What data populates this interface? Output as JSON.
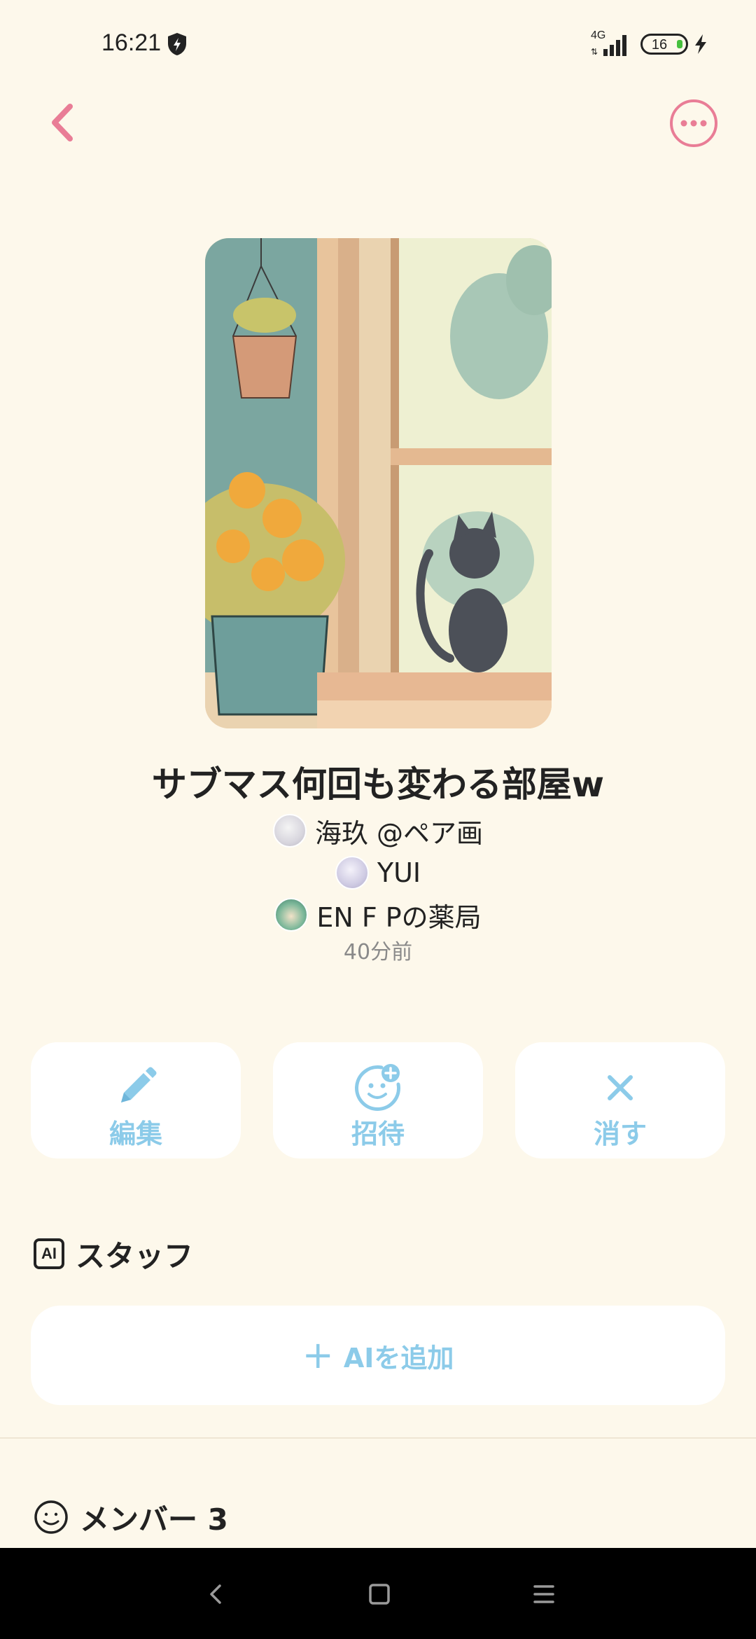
{
  "status_bar": {
    "time": "16:21",
    "network": "4G",
    "battery": "16"
  },
  "room": {
    "title": "サブマス何回も変わる部屋w",
    "members": [
      {
        "name": "海玖 @ペア画"
      },
      {
        "name": "YUI"
      },
      {
        "name": "EN F Pの薬局"
      }
    ],
    "time_ago": "40分前"
  },
  "actions": {
    "edit": "編集",
    "invite": "招待",
    "delete": "消す"
  },
  "staff_section": {
    "badge": "AI",
    "title": "スタッフ",
    "add_ai_label": "AIを追加"
  },
  "members_section": {
    "title": "メンバー 3"
  },
  "colors": {
    "background": "#FDF8EB",
    "accent_pink": "#E97D96",
    "accent_blue": "#8CCBE9"
  }
}
